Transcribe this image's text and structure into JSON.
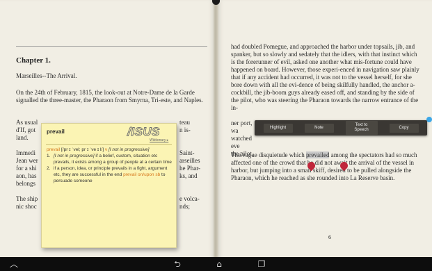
{
  "left_page": {
    "chapter_title": "Chapter 1.",
    "subtitle": "Marseilles--The Arrival.",
    "para1": "On the 24th of February, 1815, the look-out at Notre-Dame de la Garde signalled the three-master, the Pharaon from Smyrna, Tri-este, and Naples.",
    "partial_lines_left": [
      "As usual",
      "d'If, got",
      "land.",
      "",
      "Immedi",
      "Jean wer",
      "for a shi",
      "aon, has",
      "belongs",
      "",
      "The ship",
      "nic shoc"
    ],
    "partial_lines_right": [
      "teau",
      "n is-",
      "",
      "",
      "Saint-",
      "arseilles",
      "he Phar-",
      "ks, and",
      "",
      "",
      "e volca-",
      "nds;"
    ]
  },
  "right_page": {
    "para1_before": "had doubled Pomegue, and approached the harbor under topsails, jib, and spanker, but so slowly and sedately that the idlers, with that instinct which is the forerunner of evil, asked one another what mis-fortune could have happened on board. However, those experi-enced in navigation saw plainly that if any accident had occurred, it was not to the vessel herself, for she bore down with all the evi-dence of being skilfully handled, the anchor a-cockbill, the jib-boom guys already eased off, and standing by the side of the pilot, who was steering the Pharaon towards the narrow entrance of the in-",
    "para1_line_a": "ner port, wa",
    "para1_line_b": "watched eve",
    "para1_line_c": "the pilot.",
    "para2_before": "The vague disquietude which ",
    "para2_highlight": "prevailed",
    "para2_after": " among the spectators had so much affected one of the crowd that he did not await the arrival of the vessel in harbor, but jumping into a small skiff, desired to be pulled alongside the Pharaon, which he reached as she rounded into La Reserve basin.",
    "page_number": "6"
  },
  "toolbar": {
    "highlight": "Highlight",
    "note": "Note",
    "text_to_speech": "Text to Speech",
    "copy": "Copy"
  },
  "dictionary": {
    "headword": "prevail",
    "logo": "/ISUS",
    "source": "Wiktionary ▸",
    "pos_line_word": "prevail",
    "pos_line_ipa": " [/pr ɪ ˈvel; pr ɪ ˈve ɪ l/] ",
    "pos_line_pos": "v",
    "pos_line_rest": " [I not in progressive]",
    "sense1_num": "1.",
    "sense1_tag": "[I not in progressive]",
    "sense1_text": " if a belief, custom, situation etc prevails, it exists among a group of people at a certain time",
    "sense2_num": "2.",
    "sense2_tag": "",
    "sense2_text": "if a person, idea, or principle prevails in a fight, argument etc, they are successful in the end ",
    "sense2_phrase": "prevail on/upon sb",
    "sense2_tail": " to persuade someone"
  },
  "navbar": {
    "back_icon": "back-icon",
    "home_icon": "home-icon",
    "recent_icon": "recent-apps-icon",
    "up_icon": "chevron-up-icon",
    "back_glyph": "⮌",
    "home_glyph": "⌂",
    "recent_glyph": "❐",
    "up_glyph": "︿"
  }
}
